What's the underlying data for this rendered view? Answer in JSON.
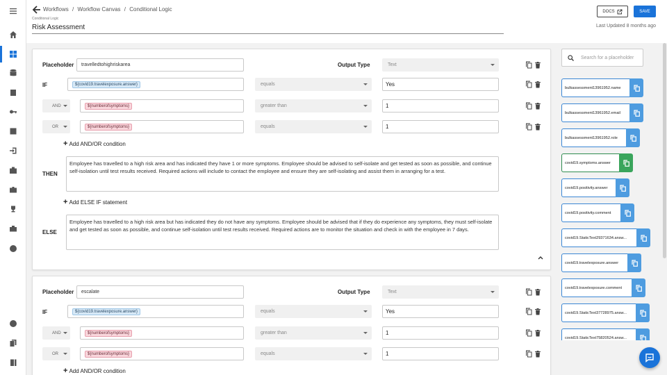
{
  "breadcrumb": [
    "Workflows",
    "/",
    "Workflow Canvas",
    "/",
    "Conditional Logic"
  ],
  "title_field": {
    "label": "Conditional Logic",
    "value": "Risk Assessment"
  },
  "header": {
    "docs_label": "DOCS",
    "save_label": "SAVE",
    "last_updated": "Last Updated 8 months ago"
  },
  "nav_icons": [
    "menu-icon",
    "home-icon",
    "grid-icon",
    "database-icon",
    "clipboard-check-icon",
    "key-icon",
    "contact-card-icon",
    "sign-in-icon",
    "medical-bag-icon",
    "briefcase-icon",
    "trophy-icon",
    "toolbox-icon",
    "help-icon",
    "face-icon",
    "documents-icon",
    "library-icon"
  ],
  "labels": {
    "placeholder": "Placeholder",
    "output_type": "Output Type",
    "if": "IF",
    "then": "THEN",
    "else": "ELSE",
    "add_condition": "Add AND/OR condition",
    "add_else_if": "Add ELSE IF statement"
  },
  "card1": {
    "placeholder_value": "travelledtohighriskarea",
    "output_type": "Text",
    "conditions": [
      {
        "joiner": "",
        "variable": "${covid19.travelexposure.answer}",
        "variable_color": "blue",
        "operator": "equals",
        "value": "Yes"
      },
      {
        "joiner": "AND",
        "variable": "${numberofsymptoms}",
        "variable_color": "pink",
        "operator": "greater than",
        "value": "1"
      },
      {
        "joiner": "OR",
        "variable": "${numberofsymptoms}",
        "variable_color": "pink",
        "operator": "equals",
        "value": "1"
      }
    ],
    "then_text": "Employee has travelled to a high risk area and has indicated they have 1 or more symptoms. Employee should be advised to self-isolate and get tested as soon as possible, and continue self-isolation until test results received. Required actions will include to contact the employee and ensure they are self-isolating and assist them in arranging for a test.",
    "else_text": "Employee has travelled to a high risk area but has indicated they do not have any symptoms. Employee should be advised that if they do experience any symptoms, they must self-isolate and get tested as soon as possible, and continue self-isolation until test results received. Required actions are to monitor the situation and check in with the employee in 7 days."
  },
  "card2": {
    "placeholder_value": "escalate",
    "output_type": "Text",
    "conditions": [
      {
        "joiner": "",
        "variable": "${covid19.travelexposure.answer}",
        "variable_color": "blue",
        "operator": "equals",
        "value": "Yes"
      },
      {
        "joiner": "AND",
        "variable": "${numberofsymptoms}",
        "variable_color": "pink",
        "operator": "greater than",
        "value": "1"
      },
      {
        "joiner": "OR",
        "variable": "${numberofsymptoms}",
        "variable_color": "pink",
        "operator": "equals",
        "value": "1"
      }
    ]
  },
  "placeholder_panel": {
    "search_placeholder": "Search for a placeholder",
    "items": [
      {
        "name": "bulkassessment13961952.name",
        "color": "blue"
      },
      {
        "name": "bulkassessment13961952.email",
        "color": "blue"
      },
      {
        "name": "bulkassessment13961952.role",
        "color": "blue"
      },
      {
        "name": "covid19.symptoms.answer",
        "color": "green"
      },
      {
        "name": "covid19.positivity.answer",
        "color": "blue"
      },
      {
        "name": "covid19.positivity.comment",
        "color": "blue"
      },
      {
        "name": "covid19.StaticText29371634.answ...",
        "color": "blue"
      },
      {
        "name": "covid19.travelexposure.answer",
        "color": "blue"
      },
      {
        "name": "covid19.travelexposure.comment",
        "color": "blue"
      },
      {
        "name": "covid19.StaticText37728975.answ...",
        "color": "blue"
      },
      {
        "name": "covid19.StaticText75820524.answ...",
        "color": "blue"
      }
    ]
  },
  "colors": {
    "accent": "#1a73d9",
    "chip_blue": "#d7e9f7",
    "chip_pink": "#f9d6dc",
    "placeholder_blue": "#4e9ce0",
    "placeholder_green": "#3aa55c"
  }
}
